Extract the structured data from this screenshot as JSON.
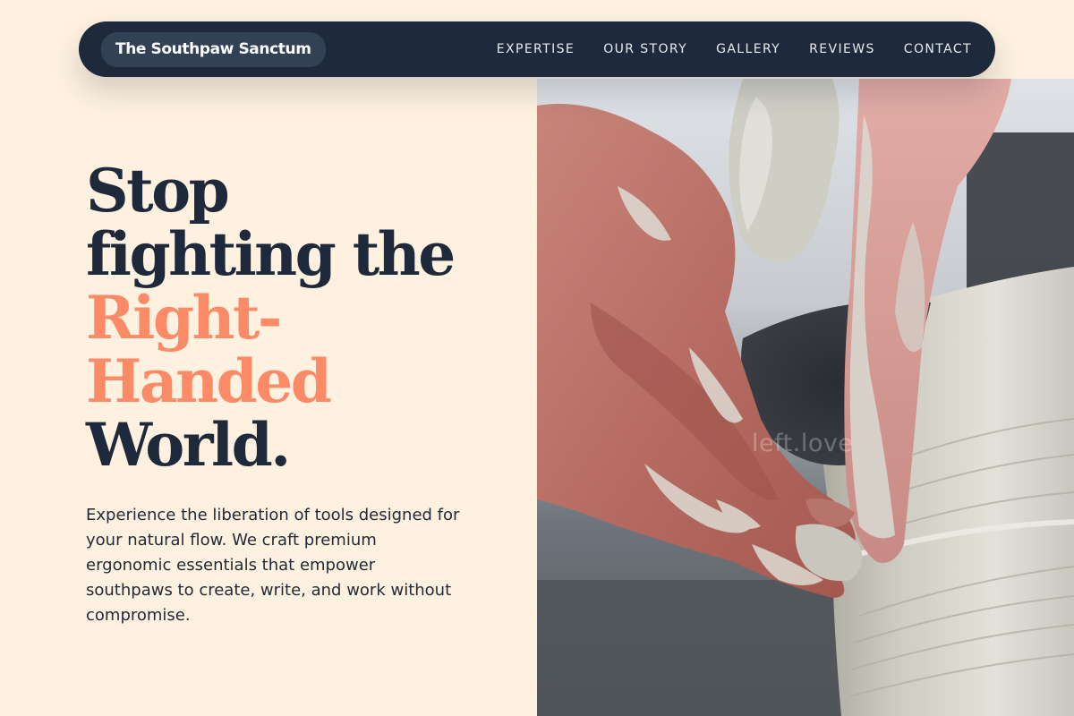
{
  "nav": {
    "brand": "The Southpaw Sanctum",
    "links": [
      "EXPERTISE",
      "OUR STORY",
      "GALLERY",
      "REVIEWS",
      "CONTACT"
    ]
  },
  "hero": {
    "headline": {
      "line1": "Stop",
      "line2": "fighting the",
      "accent1": "Right-",
      "accent2": "Handed",
      "line3": "World."
    },
    "intro": "Experience the liberation of tools designed for your natural flow. We craft premium ergonomic essentials that empower southpaws to create, write, and work without compromise.",
    "image": {
      "watermark": "left.love",
      "subject": "hands-shaping-clay-pot"
    }
  },
  "colors": {
    "background": "#fef1df",
    "navy": "#1e293b",
    "accent": "#fb8a66"
  }
}
